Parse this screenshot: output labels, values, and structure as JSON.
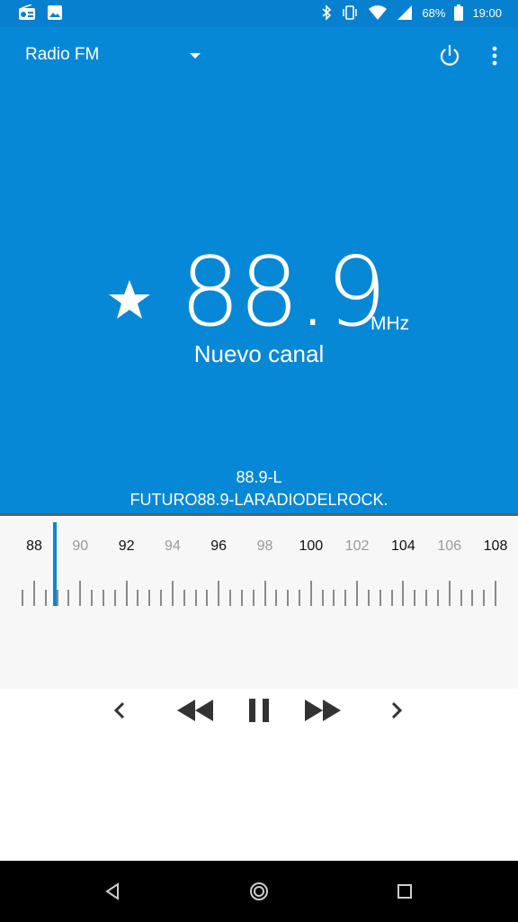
{
  "status_bar": {
    "battery": "68%",
    "time": "19:00",
    "icons": [
      "radio-icon",
      "image-icon",
      "bluetooth-icon",
      "vibrate-icon",
      "wifi-icon",
      "signal-icon",
      "battery-icon"
    ]
  },
  "app_bar": {
    "title": "Radio FM",
    "actions": [
      "power-icon",
      "more-vert-icon"
    ]
  },
  "tuner_display": {
    "frequency": "88.9",
    "unit": "MHz",
    "station_name": "Nuevo canal",
    "favorite_icon": "star-icon",
    "rds_line1": "88.9-L",
    "rds_line2": "FUTURO88.9-LARADIODELROCK."
  },
  "scale": {
    "labels": [
      "88",
      "90",
      "92",
      "94",
      "96",
      "98",
      "100",
      "102",
      "104",
      "106",
      "108"
    ],
    "current_frequency": 88.9,
    "min": 88,
    "max": 108
  },
  "controls": [
    "prev-icon",
    "rewind-icon",
    "pause-icon",
    "fast-forward-icon",
    "next-icon"
  ],
  "colors": {
    "primary": "#0788d6",
    "status_bar": "#0780cf",
    "tuner_bg": "#f7f7f7"
  }
}
